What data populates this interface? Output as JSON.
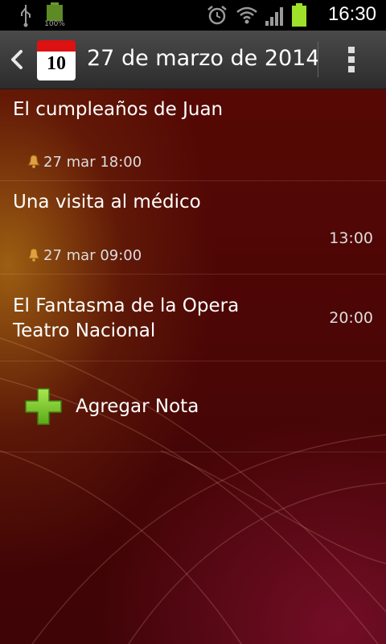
{
  "status_bar": {
    "time": "16:30",
    "battery_level": "100%",
    "icons": [
      "usb-icon",
      "battery-full-icon",
      "alarm-icon",
      "wifi-icon",
      "signal-icon",
      "battery-icon"
    ]
  },
  "action_bar": {
    "calendar_day": "10",
    "title": "27 de marzo de 2014"
  },
  "events": [
    {
      "title": "El cumpleaños de Juan",
      "time": "",
      "alarm": "27 mar 18:00"
    },
    {
      "title": "Una visita al médico",
      "time": "13:00",
      "alarm": "27 mar 09:00"
    },
    {
      "title": "El Fantasma de la Opera\nTeatro Nacional",
      "time": "20:00",
      "alarm": ""
    }
  ],
  "add_note": {
    "label": "Agregar Nota"
  },
  "colors": {
    "accent_green": "#7ccd2a",
    "calendar_red": "#dd1111",
    "background": "#4d0605"
  }
}
